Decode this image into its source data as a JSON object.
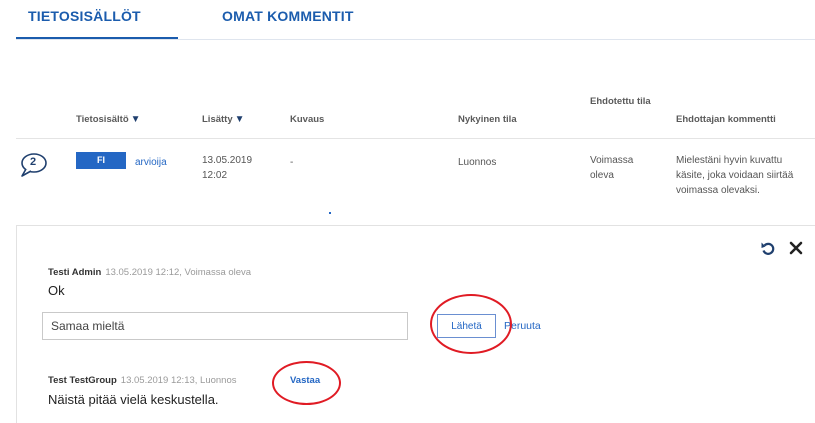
{
  "tabs": [
    {
      "label": "TIETOSISÄLLÖT",
      "active": true
    },
    {
      "label": "OMAT KOMMENTIT",
      "active": false
    }
  ],
  "columns": {
    "tietosisalto": "Tietosisältö",
    "lisatty": "Lisätty",
    "kuvaus": "Kuvaus",
    "nykyinen_tila": "Nykyinen tila",
    "ehdotettu_tila": "Ehdotettu tila",
    "ehdottajan_kommentti": "Ehdottajan kommentti"
  },
  "row": {
    "comment_count": "2",
    "language": "FI",
    "content": "arvioija",
    "added_date": "13.05.2019",
    "added_time": "12:02",
    "description": "-",
    "current_state": "Luonnos",
    "proposed_state": "Voimassa oleva",
    "proposer_comment": "Mielestäni hyvin kuvattu käsite, joka voidaan siirtää voimassa olevaksi."
  },
  "thread": {
    "comments": [
      {
        "author": "Testi Admin",
        "meta": "13.05.2019 12:12, Voimassa oleva",
        "text": "Ok"
      },
      {
        "author": "Test TestGroup",
        "meta": "13.05.2019 12:13, Luonnos",
        "text": "Näistä pitää vielä keskustella."
      }
    ],
    "reply_value": "Samaa mieltä",
    "send_label": "Lähetä",
    "cancel_label": "Peruuta",
    "reply_link": "Vastaa"
  },
  "colors": {
    "accent": "#1b5cad",
    "link": "#2467c4",
    "annotation": "#e01b24"
  },
  "icons": [
    "comment-bubble-icon",
    "sort-down-icon",
    "undo-icon",
    "close-icon"
  ]
}
